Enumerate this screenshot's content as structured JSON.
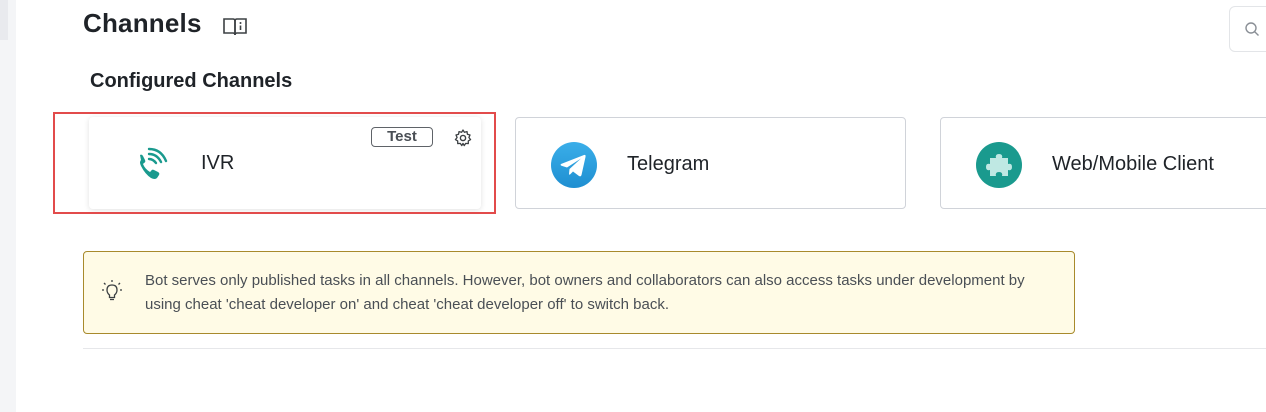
{
  "header": {
    "title": "Channels",
    "doc_icon": "book-info-icon",
    "search_icon": "search-icon"
  },
  "configured": {
    "title": "Configured Channels",
    "channels": [
      {
        "label": "IVR",
        "icon": "phone-ring-icon",
        "badge": "Test",
        "settings_icon": "gear-icon",
        "highlighted": true
      },
      {
        "label": "Telegram",
        "icon": "telegram-icon"
      },
      {
        "label": "Web/Mobile Client",
        "icon": "puzzle-icon"
      }
    ]
  },
  "notice": {
    "icon": "lightbulb-icon",
    "text": "Bot serves only published tasks in all channels. However, bot owners and collaborators can also access tasks under development by using cheat 'cheat developer on' and cheat 'cheat developer off' to switch back."
  },
  "colors": {
    "accent_teal": "#1a9a8e",
    "telegram_blue": "#2f9ad9",
    "highlight_red": "#e24b4b",
    "notice_bg": "#fffbe6",
    "notice_border": "#a88a2c"
  }
}
